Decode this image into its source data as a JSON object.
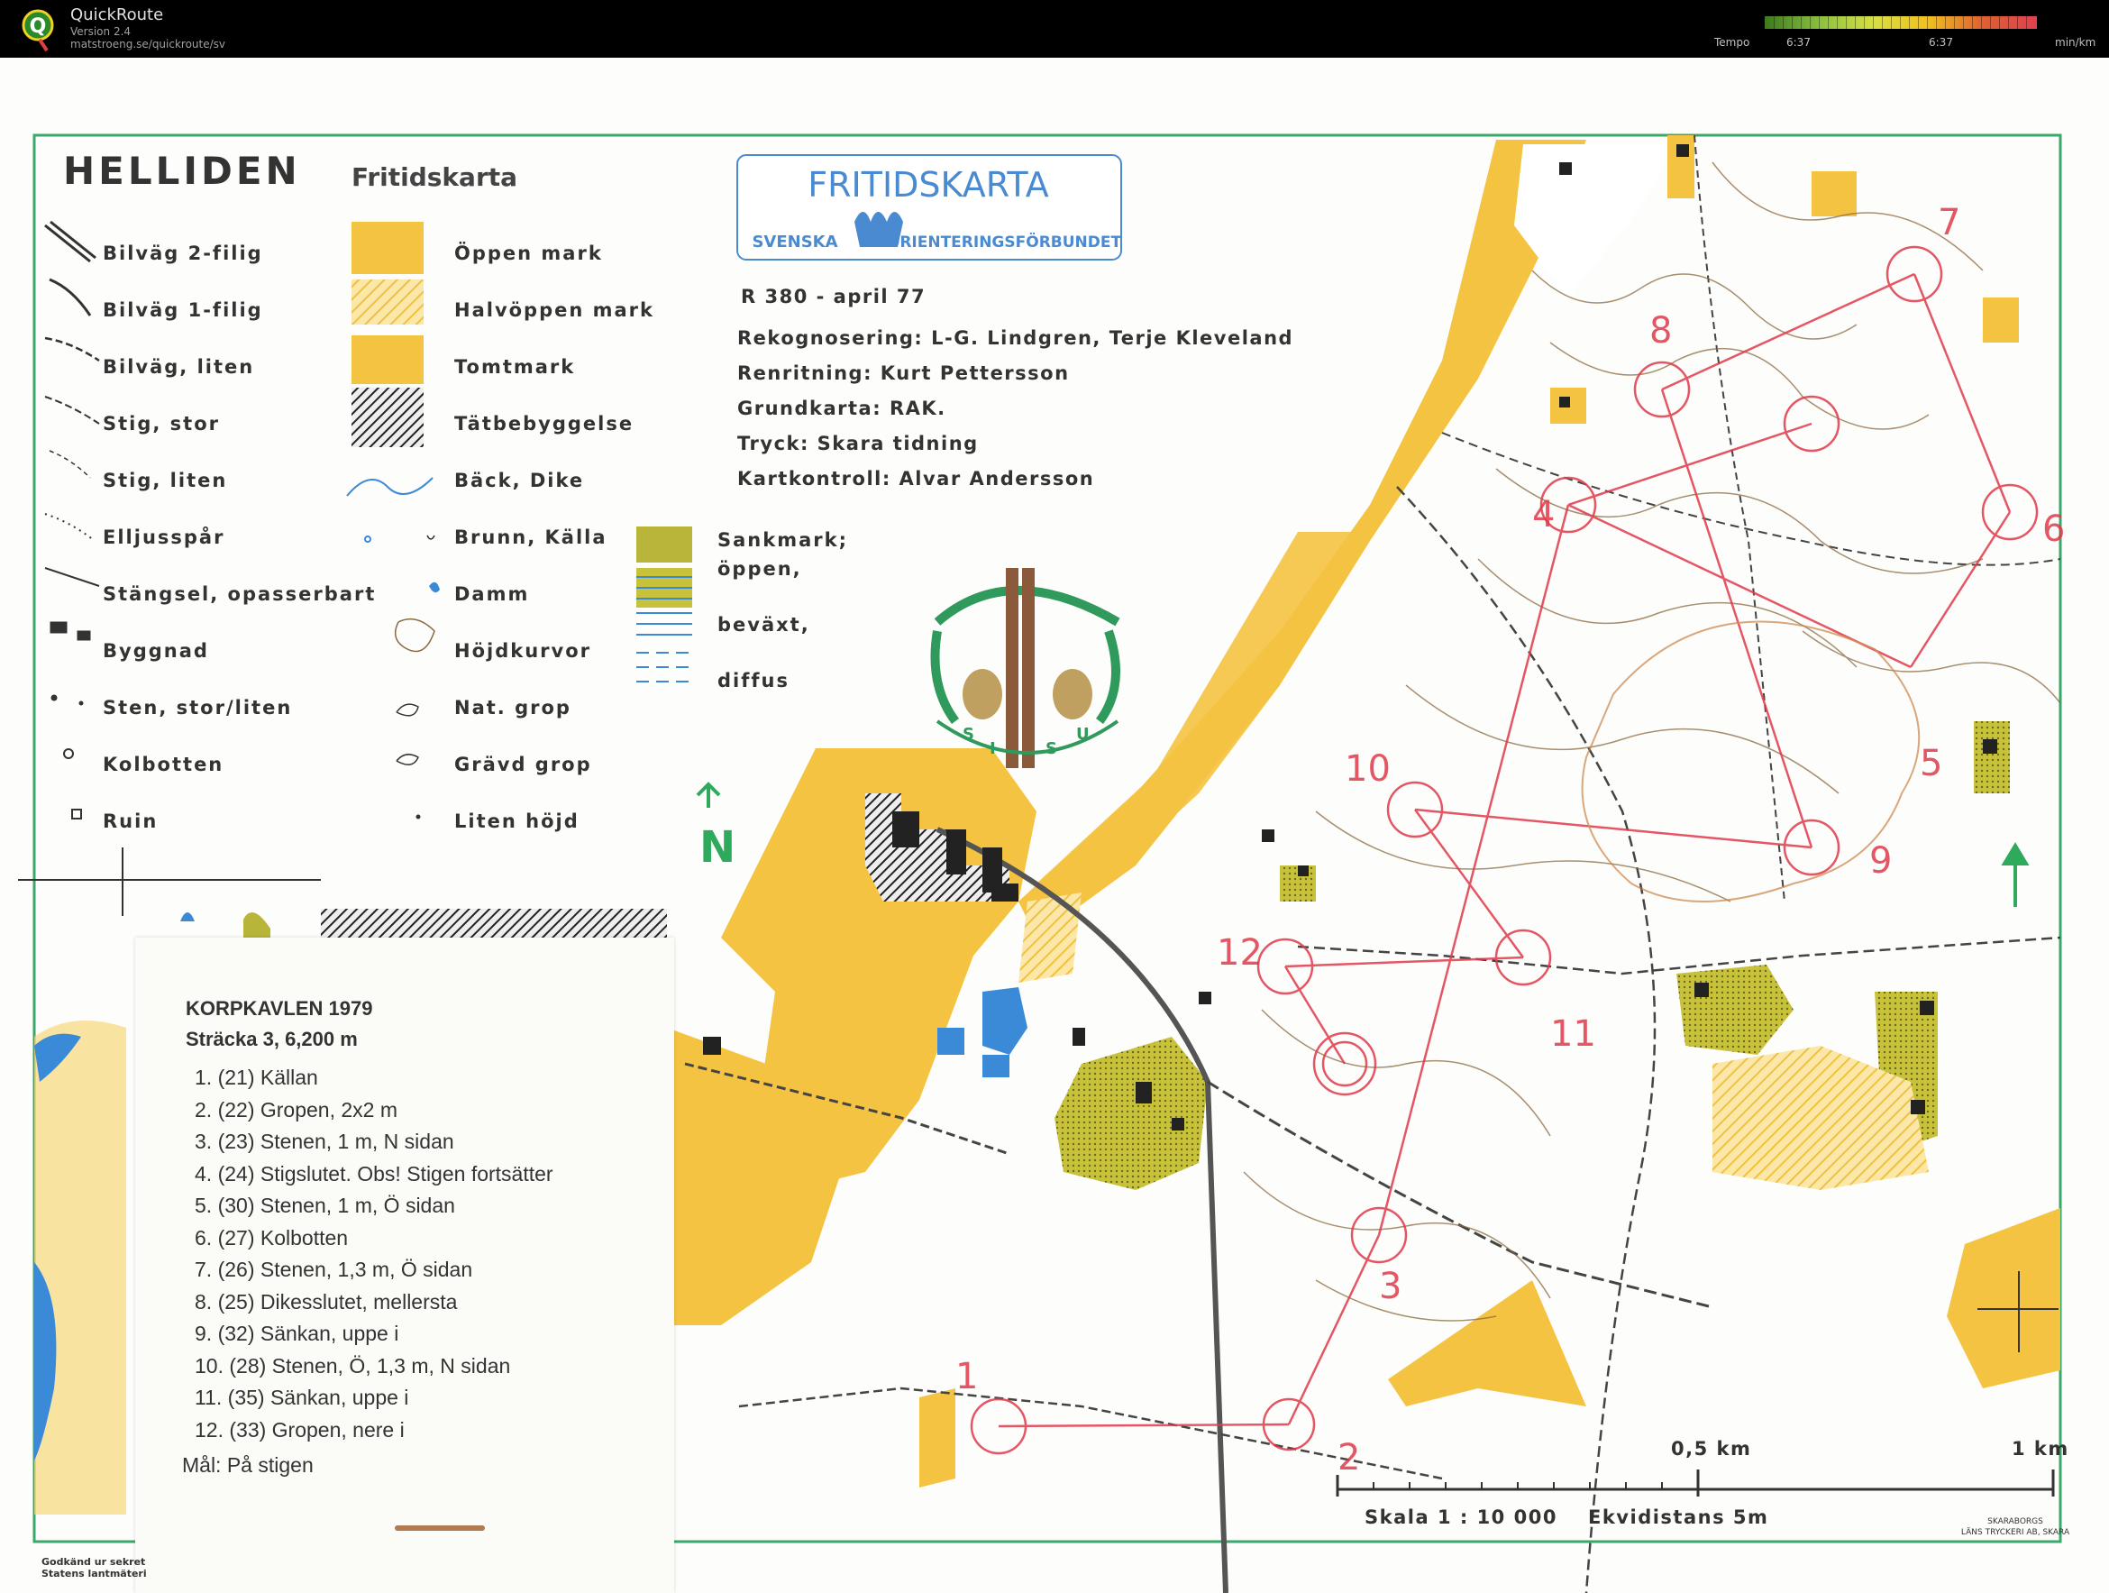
{
  "app": {
    "title": "QuickRoute",
    "version": "Version 2.4",
    "url": "matstroeng.se/quickroute/sv",
    "tempo_label": "Tempo",
    "tempo_min": "6:37",
    "tempo_max": "6:37",
    "tempo_unit": "min/km"
  },
  "map": {
    "title": "HELLIDEN",
    "subtitle": "Fritidskarta",
    "badge_title": "FRITIDSKARTA",
    "badge_left": "SVENSKA",
    "badge_right": "ORIENTERINGSFÖRBUNDET",
    "edition": "R 380  -  april  77",
    "credits": [
      "Rekognosering: L-G. Lindgren, Terje Kleveland",
      "Renritning: Kurt Pettersson",
      "Grundkarta: RAK.",
      "Tryck: Skara  tidning",
      "Kartkontroll: Alvar  Andersson"
    ],
    "logo_letters": [
      "S",
      "I",
      "S",
      "U"
    ],
    "north": "N",
    "scale_half": "0,5 km",
    "scale_full": "1 km",
    "scale_text": "Skala  1 : 10 000",
    "contour_text": "Ekvidistans  5m",
    "printer": [
      "SKARABORGS",
      "LÄNS TRYCKERI AB, SKARA"
    ],
    "approved": [
      "Godkänd ur sekret",
      "Statens lantmäteri"
    ]
  },
  "legend": {
    "col1": [
      "Bilväg  2-filig",
      "Bilväg  1-filig",
      "Bilväg, liten",
      "Stig, stor",
      "Stig, liten",
      "Elljusspår",
      "Stängsel, opasserbart",
      "Byggnad",
      "Sten, stor/liten",
      "Kolbotten",
      "Ruin"
    ],
    "col2": [
      "Öppen  mark",
      "Halvöppen  mark",
      "Tomtmark",
      "Tätbebyggelse",
      "Bäck, Dike",
      "Brunn, Källa",
      "Damm",
      "Höjdkurvor",
      "Nat. grop",
      "Grävd  grop",
      "Liten  höjd"
    ],
    "col3": [
      "Sankmark;",
      "öppen,",
      "beväxt,",
      "diffus"
    ]
  },
  "course": {
    "title": "KORPKAVLEN 1979",
    "subtitle": "Sträcka 3, 6,200 m",
    "controls": [
      "1.  (21)  Källan",
      "2.  (22)  Gropen, 2x2 m",
      "3.  (23)  Stenen, 1 m, N sidan",
      "4.  (24)  Stigslutet. Obs! Stigen fortsätter",
      "5.  (30)  Stenen, 1 m, Ö sidan",
      "6.  (27)  Kolbotten",
      "7.  (26)  Stenen, 1,3 m, Ö sidan",
      "8.  (25)  Dikesslutet, mellersta",
      "9.  (32)  Sänkan, uppe i",
      "10.  (28)  Stenen, Ö, 1,3 m, N sidan",
      "11.  (35)  Sänkan, uppe i",
      "12.  (33)  Gropen, nere i"
    ],
    "finish": "Mål: På stigen",
    "control_numbers": [
      "1",
      "2",
      "3",
      "4",
      "5",
      "6",
      "7",
      "8",
      "9",
      "10",
      "11",
      "12"
    ]
  },
  "colors": {
    "open_land": "#f5c342",
    "semi_open": "#f7d77a",
    "marsh_green": "#b8b53a",
    "course_red": "#e03a4a",
    "frame_green": "#3aa86a",
    "water_blue": "#3a8ad8"
  }
}
